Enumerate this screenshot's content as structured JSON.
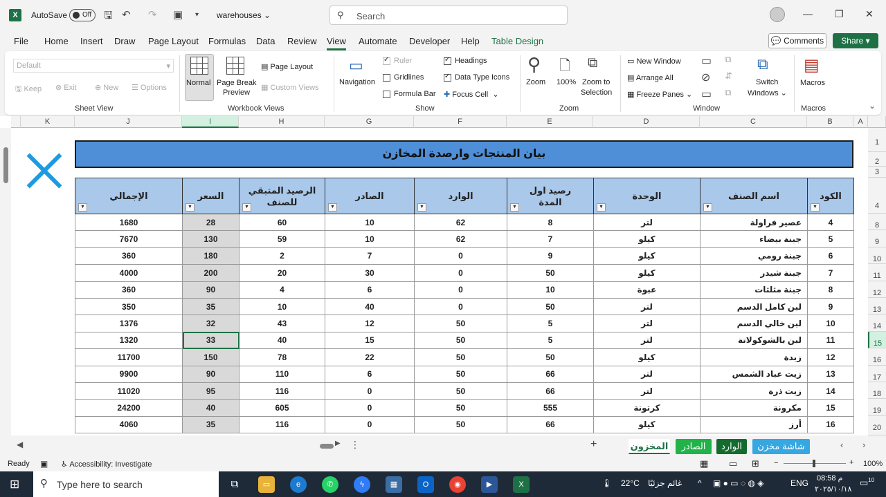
{
  "titlebar": {
    "app_icon": "X",
    "autosave_label": "AutoSave",
    "autosave_state": "Off",
    "doc_name": "warehouses",
    "search_placeholder": "Search"
  },
  "tabs": [
    "File",
    "Home",
    "Insert",
    "Draw",
    "Page Layout",
    "Formulas",
    "Data",
    "Review",
    "View",
    "Automate",
    "Developer",
    "Help",
    "Table Design"
  ],
  "active_tab": "View",
  "comments_label": "Comments",
  "share_label": "Share",
  "ribbon": {
    "sheet_view": {
      "dropdown_value": "Default",
      "keep": "Keep",
      "exit": "Exit",
      "new": "New",
      "options": "Options",
      "label": "Sheet View"
    },
    "workbook_views": {
      "normal": "Normal",
      "page_break_1": "Page Break",
      "page_break_2": "Preview",
      "page_layout": "Page Layout",
      "custom_views": "Custom Views",
      "label": "Workbook Views"
    },
    "show": {
      "navigation": "Navigation",
      "ruler": "Ruler",
      "gridlines": "Gridlines",
      "formula_bar": "Formula Bar",
      "headings": "Headings",
      "data_type_icons": "Data Type Icons",
      "focus_cell": "Focus Cell",
      "label": "Show"
    },
    "zoom": {
      "zoom": "Zoom",
      "hundred": "100%",
      "zoom_to_1": "Zoom to",
      "zoom_to_2": "Selection",
      "label": "Zoom"
    },
    "window": {
      "new_window": "New Window",
      "arrange_all": "Arrange All",
      "freeze_panes": "Freeze Panes",
      "switch_1": "Switch",
      "switch_2": "Windows",
      "label": "Window"
    },
    "macros": {
      "macros": "Macros",
      "label": "Macros"
    }
  },
  "column_headers": [
    "K",
    "J",
    "I",
    "H",
    "G",
    "F",
    "E",
    "D",
    "C",
    "B",
    "A"
  ],
  "row_numbers": [
    "1",
    "2",
    "3",
    "4",
    "8",
    "9",
    "10",
    "11",
    "12",
    "13",
    "14",
    "15",
    "16",
    "17",
    "18",
    "19",
    "20"
  ],
  "sheet": {
    "title": "بيان المنتجات وارصدة المخازن",
    "headers": [
      "الكود",
      "اسم الصنف",
      "الوحدة",
      "رصيد اول المدة",
      "الوارد",
      "الصادر",
      "الرصيد المتبقي للصنف",
      "السعر",
      "الإجمالي"
    ],
    "rows": [
      [
        "4",
        "عصير فراولة",
        "لتر",
        "8",
        "62",
        "10",
        "60",
        "28",
        "1680"
      ],
      [
        "5",
        "جبنة بيضاء",
        "كيلو",
        "7",
        "62",
        "10",
        "59",
        "130",
        "7670"
      ],
      [
        "6",
        "جبنة رومي",
        "كيلو",
        "9",
        "0",
        "7",
        "2",
        "180",
        "360"
      ],
      [
        "7",
        "جبنة شيدر",
        "كيلو",
        "50",
        "0",
        "30",
        "20",
        "200",
        "4000"
      ],
      [
        "8",
        "جبنة مثلثات",
        "عبوة",
        "10",
        "0",
        "6",
        "4",
        "90",
        "360"
      ],
      [
        "9",
        "لبن كامل الدسم",
        "لتر",
        "50",
        "0",
        "40",
        "10",
        "35",
        "350"
      ],
      [
        "10",
        "لبن خالي الدسم",
        "لتر",
        "5",
        "50",
        "12",
        "43",
        "32",
        "1376"
      ],
      [
        "11",
        "لبن بالشوكولاتة",
        "لتر",
        "5",
        "50",
        "15",
        "40",
        "33",
        "1320"
      ],
      [
        "12",
        "زبدة",
        "كيلو",
        "50",
        "50",
        "22",
        "78",
        "150",
        "11700"
      ],
      [
        "13",
        "زيت عباد الشمس",
        "لتر",
        "66",
        "50",
        "6",
        "110",
        "90",
        "9900"
      ],
      [
        "14",
        "زيت ذرة",
        "لتر",
        "66",
        "50",
        "0",
        "116",
        "95",
        "11020"
      ],
      [
        "15",
        "مكرونة",
        "كرتونة",
        "555",
        "50",
        "0",
        "605",
        "40",
        "24200"
      ],
      [
        "16",
        "أرز",
        "كيلو",
        "66",
        "50",
        "0",
        "116",
        "35",
        "4060"
      ]
    ]
  },
  "sheet_tabs": [
    {
      "label": "المخزون",
      "bg": "#ffffff",
      "color": "#1e7145"
    },
    {
      "label": "الصادر",
      "bg": "#21b24a",
      "color": "#ffffff"
    },
    {
      "label": "الوارد",
      "bg": "#146b2e",
      "color": "#ffffff"
    },
    {
      "label": "شاشة مخزن",
      "bg": "#36a7e0",
      "color": "#ffffff"
    }
  ],
  "statusbar": {
    "ready": "Ready",
    "accessibility": "Accessibility: Investigate",
    "zoom": "100%"
  },
  "taskbar": {
    "search_placeholder": "Type here to search",
    "temperature": "22°C",
    "weather": "غائم جزئيًا",
    "lang": "ENG",
    "time": "08:58 م",
    "date": "٢٠٢٥/١٠/١٨",
    "notif_count": "10"
  }
}
